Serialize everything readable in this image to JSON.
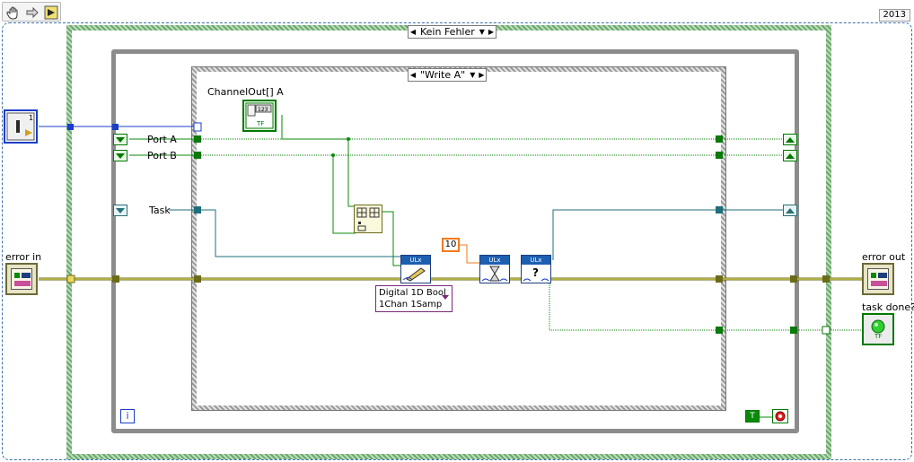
{
  "version_label": "2013",
  "toolbar": {
    "hand_icon": "hand-tool-icon",
    "arrow_icon": "arrow-icon",
    "run_icon": "run-arrow-icon"
  },
  "outer_case": {
    "selector_label": "Kein Fehler"
  },
  "inner_case": {
    "selector_label": "\"Write A\""
  },
  "controls": {
    "port_a": "Port A",
    "port_b": "Port B",
    "task": "Task",
    "channel_out": "ChannelOut[] A",
    "error_in": "error in",
    "error_out": "error out",
    "task_done": "task done?"
  },
  "constants": {
    "timeout": "10",
    "poly_select_line1": "Digital 1D Bool",
    "poly_select_line2": "1Chan 1Samp"
  },
  "subvis": {
    "write": "ULx",
    "wait": "ULx",
    "query": "ULx"
  },
  "loop": {
    "iteration_label": "i",
    "condition_label": "T"
  },
  "bool_labels": {
    "tf": "TF"
  },
  "colors": {
    "case_border": "#8fbf8f",
    "loop_border": "#8c8c8c",
    "bool_wire": "#0a8a0a",
    "error_wire": "#8a8a2a",
    "task_wire": "#1d6f7a",
    "const_border": "#f27a1c"
  }
}
